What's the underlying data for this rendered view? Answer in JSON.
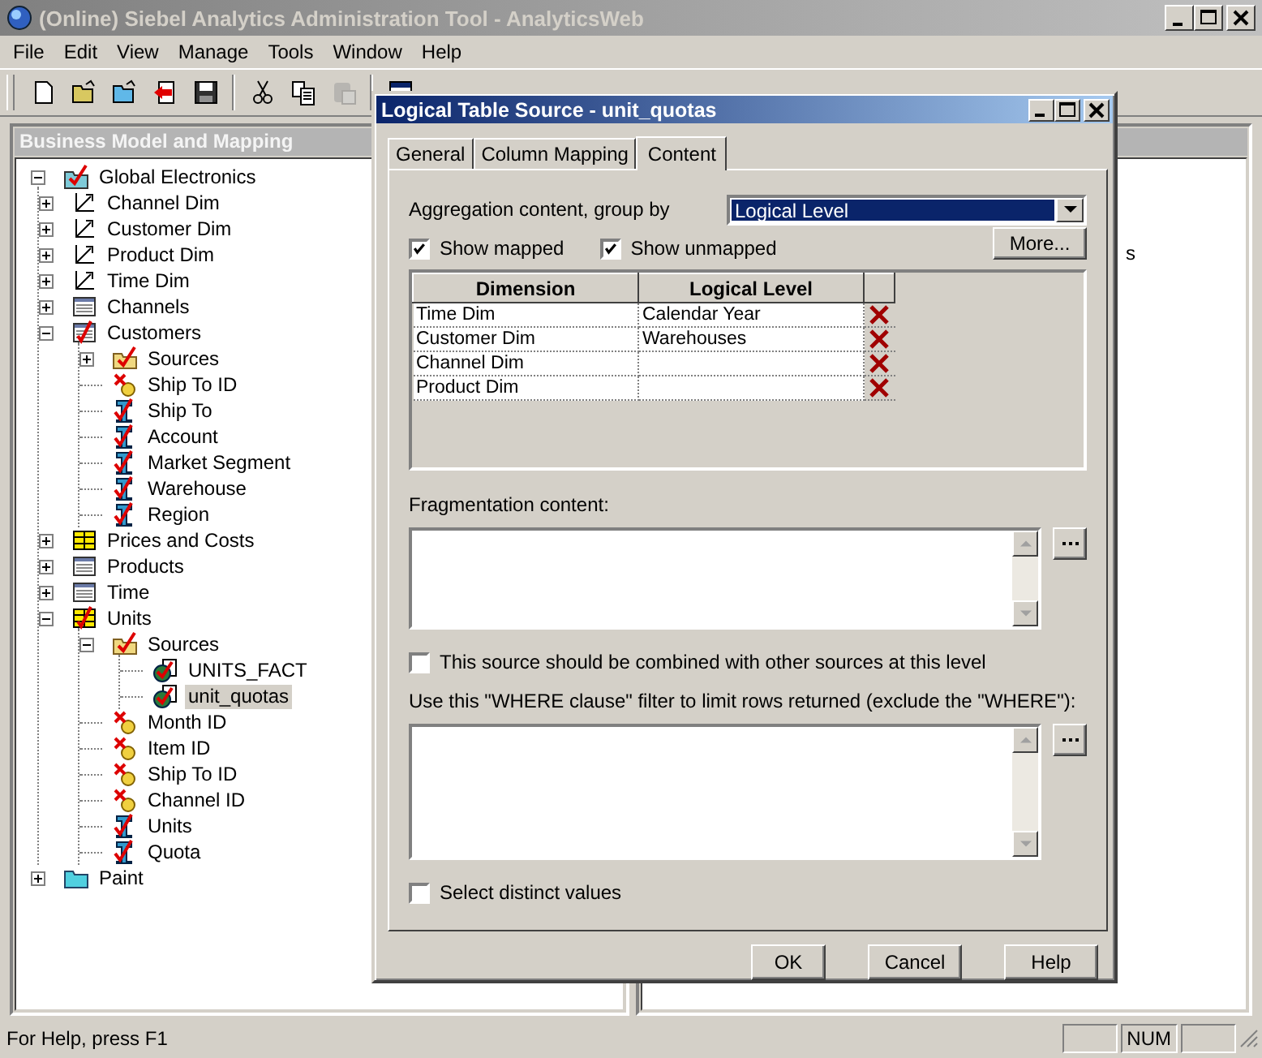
{
  "window": {
    "title": "(Online) Siebel Analytics Administration Tool - AnalyticsWeb"
  },
  "menu": [
    "File",
    "Edit",
    "View",
    "Manage",
    "Tools",
    "Window",
    "Help"
  ],
  "toolbar": [
    [
      {
        "kind": "new",
        "disabled": false
      },
      {
        "kind": "open",
        "disabled": false
      },
      {
        "kind": "open-online",
        "disabled": false
      },
      {
        "kind": "import",
        "disabled": false
      },
      {
        "kind": "save",
        "disabled": false
      }
    ],
    [
      {
        "kind": "cut",
        "disabled": false
      },
      {
        "kind": "copy",
        "disabled": false
      },
      {
        "kind": "paste",
        "disabled": true
      }
    ],
    [
      {
        "kind": "window",
        "disabled": false
      }
    ]
  ],
  "left_panel": {
    "title": "Business Model and Mapping",
    "tree": [
      {
        "label": "Global Electronics",
        "kind": "model",
        "expanded": true,
        "selected": false,
        "children": [
          {
            "label": "Channel Dim",
            "kind": "dimension",
            "expanded": false,
            "selected": false
          },
          {
            "label": "Customer Dim",
            "kind": "dimension",
            "expanded": false,
            "selected": false
          },
          {
            "label": "Product Dim",
            "kind": "dimension",
            "expanded": false,
            "selected": false
          },
          {
            "label": "Time Dim",
            "kind": "dimension",
            "expanded": false,
            "selected": false
          },
          {
            "label": "Channels",
            "kind": "table",
            "expanded": false,
            "selected": false
          },
          {
            "label": "Customers",
            "kind": "table-checked",
            "expanded": true,
            "selected": false,
            "children": [
              {
                "label": "Sources",
                "kind": "sources",
                "expanded": false,
                "selected": false
              },
              {
                "label": "Ship To ID",
                "kind": "key",
                "selected": false
              },
              {
                "label": "Ship To",
                "kind": "column",
                "selected": false
              },
              {
                "label": "Account",
                "kind": "column",
                "selected": false
              },
              {
                "label": "Market Segment",
                "kind": "column",
                "selected": false
              },
              {
                "label": "Warehouse",
                "kind": "column",
                "selected": false
              },
              {
                "label": "Region",
                "kind": "column",
                "selected": false
              }
            ]
          },
          {
            "label": "Prices and Costs",
            "kind": "fact",
            "expanded": false,
            "selected": false
          },
          {
            "label": "Products",
            "kind": "table",
            "expanded": false,
            "selected": false
          },
          {
            "label": "Time",
            "kind": "table",
            "expanded": false,
            "selected": false
          },
          {
            "label": "Units",
            "kind": "fact-checked",
            "expanded": true,
            "selected": false,
            "children": [
              {
                "label": "Sources",
                "kind": "sources",
                "expanded": true,
                "selected": false,
                "children": [
                  {
                    "label": "UNITS_FACT",
                    "kind": "source",
                    "selected": false
                  },
                  {
                    "label": "unit_quotas",
                    "kind": "source",
                    "selected": true
                  }
                ]
              },
              {
                "label": "Month ID",
                "kind": "key",
                "selected": false
              },
              {
                "label": "Item ID",
                "kind": "key",
                "selected": false
              },
              {
                "label": "Ship To ID",
                "kind": "key",
                "selected": false
              },
              {
                "label": "Channel ID",
                "kind": "key",
                "selected": false
              },
              {
                "label": "Units",
                "kind": "column",
                "selected": false
              },
              {
                "label": "Quota",
                "kind": "column",
                "selected": false
              }
            ]
          }
        ]
      },
      {
        "label": "Paint",
        "kind": "folder",
        "expanded": false,
        "selected": false
      }
    ]
  },
  "right_panel": {
    "text": "s"
  },
  "dialog": {
    "title": "Logical Table Source - unit_quotas",
    "tabs": [
      {
        "label": "General",
        "selected": false
      },
      {
        "label": "Column Mapping",
        "selected": false
      },
      {
        "label": "Content",
        "selected": true
      }
    ],
    "aggregation_label": "Aggregation content, group by",
    "group_by": {
      "value": "Logical Level"
    },
    "show_mapped": {
      "label": "Show mapped",
      "checked": true
    },
    "show_unmapped": {
      "label": "Show unmapped",
      "checked": true
    },
    "more_button": "More...",
    "grid": {
      "columns": [
        "Dimension",
        "Logical Level"
      ],
      "rows": [
        {
          "dimension": "Time Dim",
          "level": "Calendar Year"
        },
        {
          "dimension": "Customer Dim",
          "level": "Warehouses"
        },
        {
          "dimension": "Channel Dim"
        },
        {
          "dimension": "Product Dim"
        }
      ]
    },
    "fragmentation_label": "Fragmentation content:",
    "combine": {
      "label": "This source should be combined with other sources at this level",
      "checked": false
    },
    "where_label": "Use this \"WHERE clause\" filter to limit rows returned (exclude the \"WHERE\"):",
    "distinct": {
      "label": "Select distinct values",
      "checked": false
    },
    "buttons": [
      "OK",
      "Cancel",
      "Help"
    ]
  },
  "status_bar": {
    "text": "For Help, press F1",
    "indicator": "NUM"
  }
}
